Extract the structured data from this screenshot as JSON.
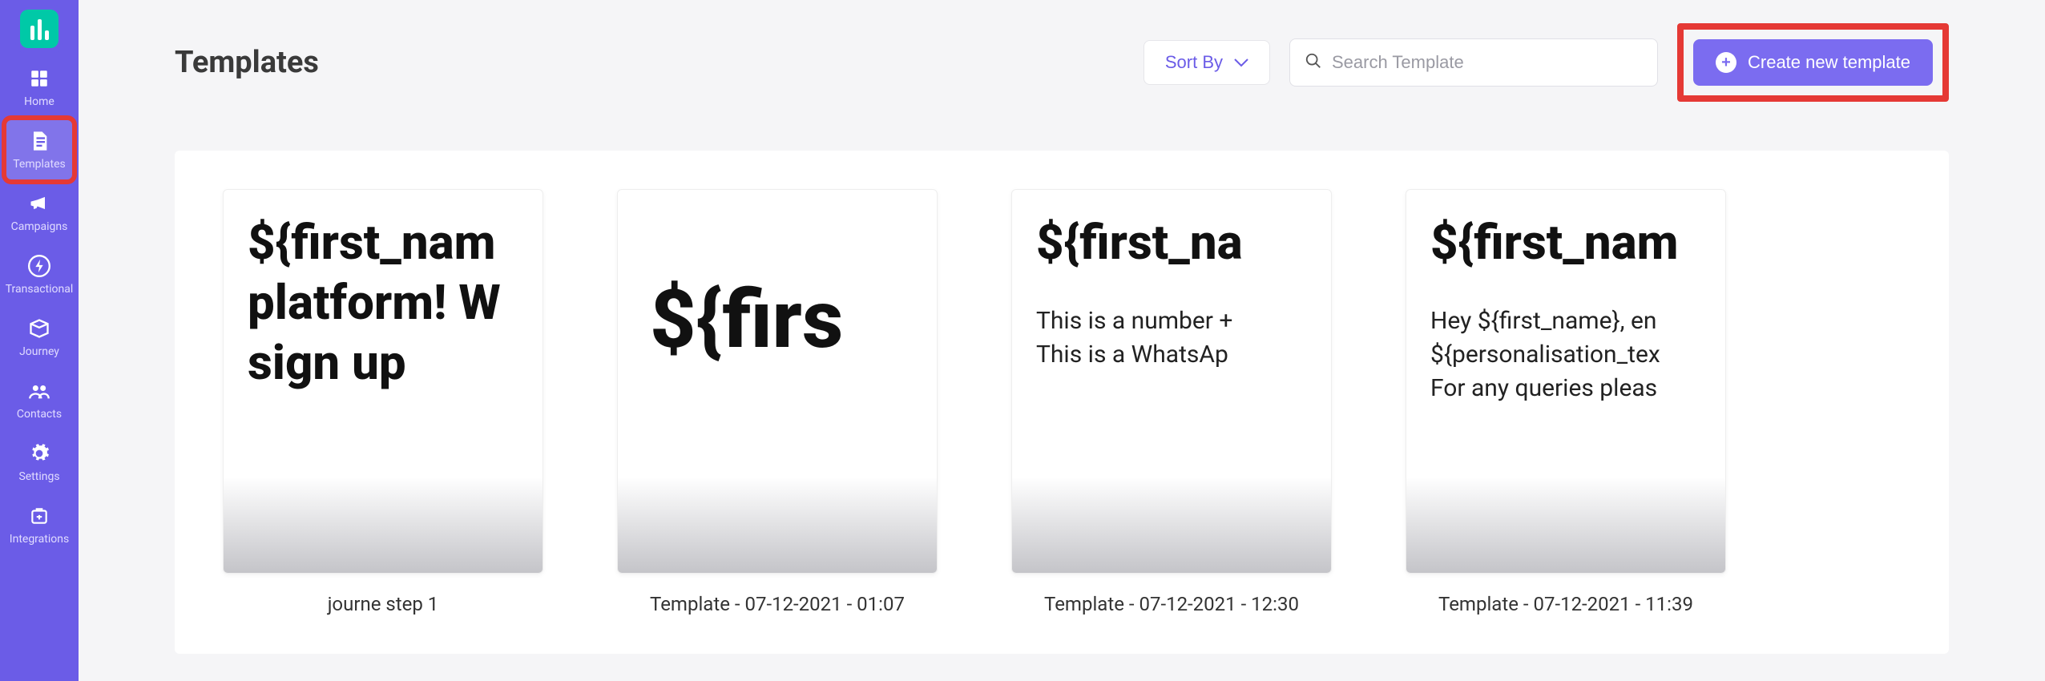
{
  "sidebar": {
    "items": [
      {
        "label": "Home"
      },
      {
        "label": "Templates"
      },
      {
        "label": "Campaigns"
      },
      {
        "label": "Transactional"
      },
      {
        "label": "Journey"
      },
      {
        "label": "Contacts"
      },
      {
        "label": "Settings"
      },
      {
        "label": "Integrations"
      }
    ]
  },
  "header": {
    "title": "Templates",
    "sort_label": "Sort By",
    "search_placeholder": "Search Template",
    "create_label": "Create new template"
  },
  "templates": [
    {
      "name": "journe step 1",
      "preview_lines": [
        "${first_nam",
        "platform! W",
        "sign up"
      ],
      "body_lines": []
    },
    {
      "name": "Template - 07-12-2021 - 01:07",
      "preview_lines": [
        "${firs"
      ],
      "body_lines": []
    },
    {
      "name": "Template - 07-12-2021 - 12:30",
      "preview_lines": [
        "${first_na"
      ],
      "body_lines": [
        "This is a number +",
        "This is a WhatsAp"
      ]
    },
    {
      "name": "Template - 07-12-2021 - 11:39",
      "preview_lines": [
        "${first_nam"
      ],
      "body_lines": [
        "Hey ${first_name}, en",
        "${personalisation_tex",
        "For any queries pleas"
      ]
    }
  ]
}
